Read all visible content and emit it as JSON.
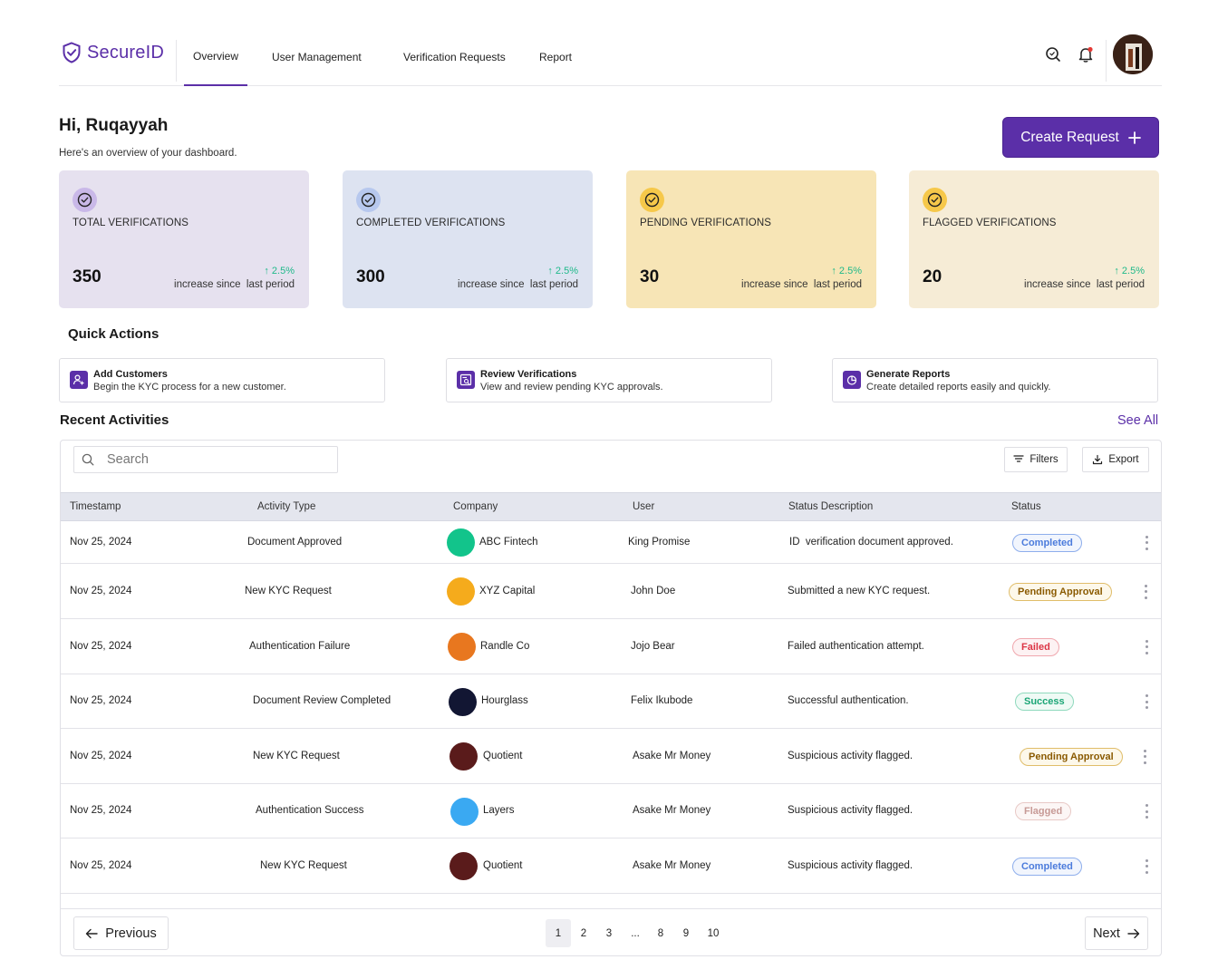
{
  "app": {
    "name": "SecureID"
  },
  "nav": {
    "items": [
      {
        "label": "Overview",
        "active": true
      },
      {
        "label": "User Management",
        "active": false
      },
      {
        "label": "Verification Requests",
        "active": false
      },
      {
        "label": "Report",
        "active": false
      }
    ],
    "icons": [
      "search-icon",
      "bell-icon"
    ]
  },
  "greeting": {
    "title": "Hi, Ruqayyah",
    "subtitle": "Here's an overview of your dashboard."
  },
  "create_request": {
    "label": "Create Request"
  },
  "stats": [
    {
      "label": "TOTAL VERIFICATIONS",
      "value": "350",
      "trend": "2.5%",
      "note": "increase since  last period",
      "bg": "#e6e1ef",
      "icon_bg": "#c9b8e8"
    },
    {
      "label": "COMPLETED VERIFICATIONS",
      "value": "300",
      "trend": "2.5%",
      "note": "increase since  last period",
      "bg": "#dde3f1",
      "icon_bg": "#b7c8ee"
    },
    {
      "label": "PENDING VERIFICATIONS",
      "value": "30",
      "trend": "2.5%",
      "note": "increase since  last period",
      "bg": "#f7e5b6",
      "icon_bg": "#f6c84a"
    },
    {
      "label": "FLAGGED VERIFICATIONS",
      "value": "20",
      "trend": "2.5%",
      "note": "increase since  last period",
      "bg": "#f6ecd6",
      "icon_bg": "#f6c84a"
    }
  ],
  "quick_actions": {
    "title": "Quick Actions",
    "items": [
      {
        "title": "Add Customers",
        "desc": "Begin the KYC process for a new customer.",
        "icon": "add-user-icon"
      },
      {
        "title": "Review Verifications",
        "desc": "View and review pending KYC approvals.",
        "icon": "review-document-icon"
      },
      {
        "title": "Generate Reports",
        "desc": "Create detailed reports easily and quickly.",
        "icon": "pie-chart-icon"
      }
    ]
  },
  "recent": {
    "title": "Recent Activities",
    "see_all": "See All",
    "search_placeholder": "Search",
    "filters_label": "Filters",
    "export_label": "Export",
    "columns": [
      "Timestamp",
      "Activity Type",
      "Company",
      "User",
      "Status Description",
      "Status"
    ],
    "rows": [
      {
        "timestamp": "Nov 25, 2024",
        "activity": "Document Approved",
        "company": "ABC Fintech",
        "company_color": "#12c48b",
        "user": "King Promise",
        "desc": "ID  verification document approved.",
        "status": "Completed"
      },
      {
        "timestamp": "Nov 25, 2024",
        "activity": "New KYC Request",
        "company": "XYZ Capital",
        "company_color": "#f5ab1c",
        "user": "John Doe",
        "desc": "Submitted a new KYC request.",
        "status": "Pending Approval"
      },
      {
        "timestamp": "Nov 25, 2024",
        "activity": "Authentication Failure",
        "company": "Randle Co",
        "company_color": "#e8771f",
        "user": "Jojo Bear",
        "desc": "Failed authentication attempt.",
        "status": "Failed"
      },
      {
        "timestamp": "Nov 25, 2024",
        "activity": "Document Review Completed",
        "company": "Hourglass",
        "company_color": "#121633",
        "user": "Felix Ikubode",
        "desc": "Successful authentication.",
        "status": "Success"
      },
      {
        "timestamp": "Nov 25, 2024",
        "activity": "New KYC Request",
        "company": "Quotient",
        "company_color": "#5a1b1b",
        "user": "Asake Mr Money",
        "desc": "Suspicious activity flagged.",
        "status": "Pending Approval"
      },
      {
        "timestamp": "Nov 25, 2024",
        "activity": "Authentication Success",
        "company": "Layers",
        "company_color": "#3aa9f2",
        "user": "Asake Mr Money",
        "desc": "Suspicious activity flagged.",
        "status": "Flagged"
      },
      {
        "timestamp": "Nov 25, 2024",
        "activity": "New KYC Request",
        "company": "Quotient",
        "company_color": "#5a1b1b",
        "user": "Asake Mr Money",
        "desc": "Suspicious activity flagged.",
        "status": "Completed"
      }
    ]
  },
  "status_colors": {
    "Completed": {
      "fg": "#4b7bdc",
      "border": "#8eaeec",
      "bg": "#f1f5fd"
    },
    "Pending Approval": {
      "fg": "#8a5a00",
      "border": "#e0bd6a",
      "bg": "#fdf8ea"
    },
    "Failed": {
      "fg": "#dc3545",
      "border": "#f0a7ae",
      "bg": "#fdf2f3"
    },
    "Success": {
      "fg": "#1aa575",
      "border": "#8fd9bd",
      "bg": "#effaf5"
    },
    "Flagged": {
      "fg": "#c79a96",
      "border": "#e8c9c6",
      "bg": "#fcf6f5"
    }
  },
  "pagination": {
    "previous": "Previous",
    "next": "Next",
    "pages": [
      "1",
      "2",
      "3",
      "...",
      "8",
      "9",
      "10"
    ],
    "current": "1"
  }
}
